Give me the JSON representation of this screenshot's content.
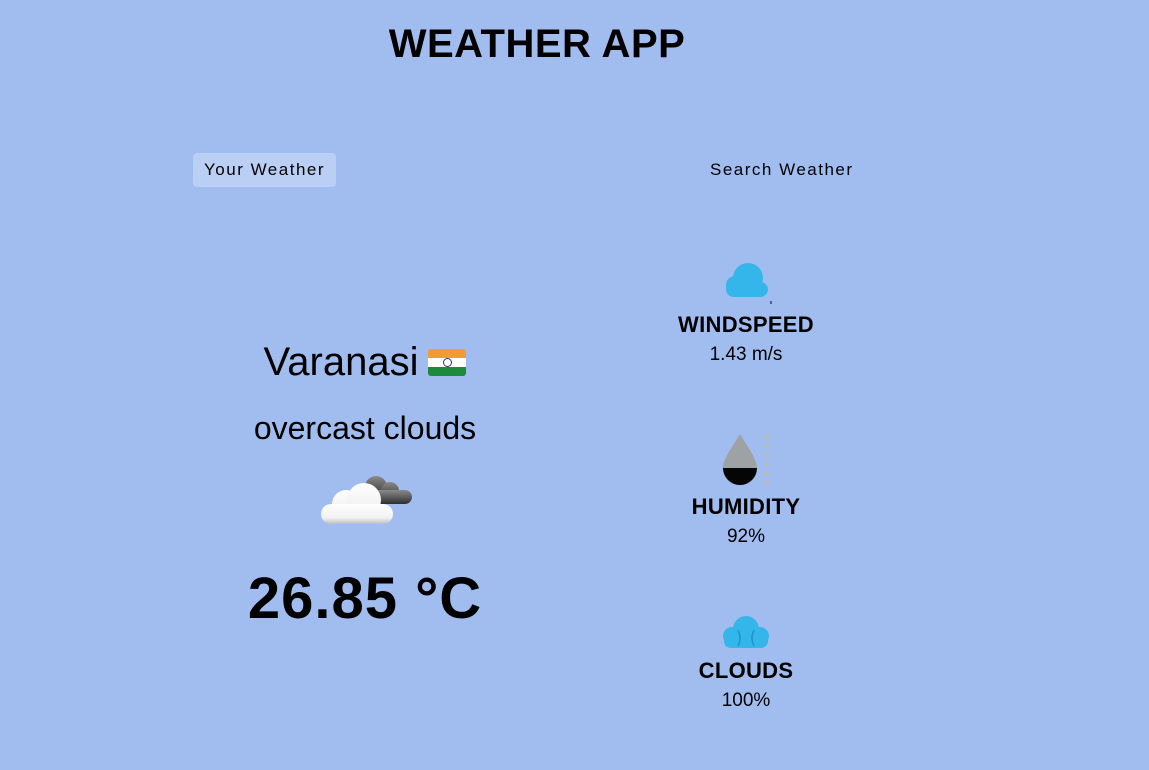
{
  "app": {
    "title": "WEATHER APP"
  },
  "tabs": [
    {
      "label": "Your Weather",
      "active": true
    },
    {
      "label": "Search Weather",
      "active": false
    }
  ],
  "current": {
    "city": "Varanasi",
    "country_flag": "india-flag-icon",
    "description": "overcast clouds",
    "condition_icon": "overcast-clouds-icon",
    "temperature": "26.85 °C"
  },
  "stats": {
    "windspeed": {
      "label": "WINDSPEED",
      "value": "1.43 m/s",
      "icon": "wind-cloud-icon"
    },
    "humidity": {
      "label": "HUMIDITY",
      "value": "92%",
      "icon": "humidity-drop-icon"
    },
    "clouds": {
      "label": "CLOUDS",
      "value": "100%",
      "icon": "cloud-icon"
    }
  },
  "colors": {
    "background": "#a1bdf0",
    "accent_blue": "#35b6ea"
  }
}
